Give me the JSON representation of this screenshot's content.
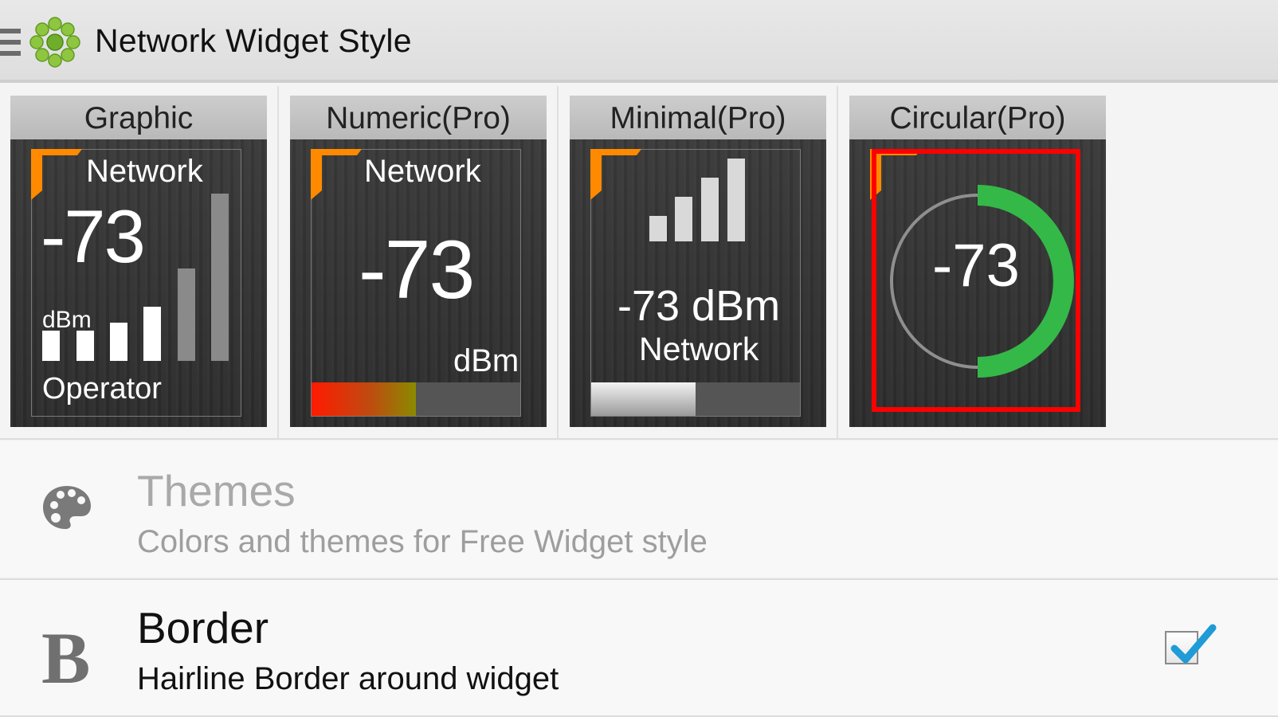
{
  "header": {
    "title": "Network Widget Style",
    "logo": "green-flower-logo",
    "menu_icon": "hamburger-menu-icon"
  },
  "styles": [
    {
      "label": "Graphic",
      "network": "Network",
      "value": "-73",
      "unit": "dBm",
      "operator": "Operator",
      "signal_bars_active": 4,
      "signal_bars_total": 6
    },
    {
      "label": "Numeric(Pro)",
      "network": "Network",
      "value": "-73",
      "unit": "dBm",
      "signal_fraction": 0.5
    },
    {
      "label": "Minimal(Pro)",
      "value_text": "-73 dBm",
      "network": "Network",
      "signal_bars": 4,
      "signal_fraction": 0.5
    },
    {
      "label": "Circular(Pro)",
      "value": "-73",
      "signal_fraction": 0.5,
      "selected": true
    }
  ],
  "settings": {
    "themes": {
      "title": "Themes",
      "subtitle": "Colors and themes for Free Widget style",
      "enabled": false,
      "icon": "palette-icon"
    },
    "border": {
      "title": "Border",
      "subtitle": "Hairline Border around widget",
      "checked": true,
      "icon": "bold-b-icon"
    }
  },
  "colors": {
    "accent_orange": "#ff8a00",
    "selection_red": "#ff0000",
    "ring_green": "#34b848",
    "checkmark_blue": "#1f9bd7"
  }
}
